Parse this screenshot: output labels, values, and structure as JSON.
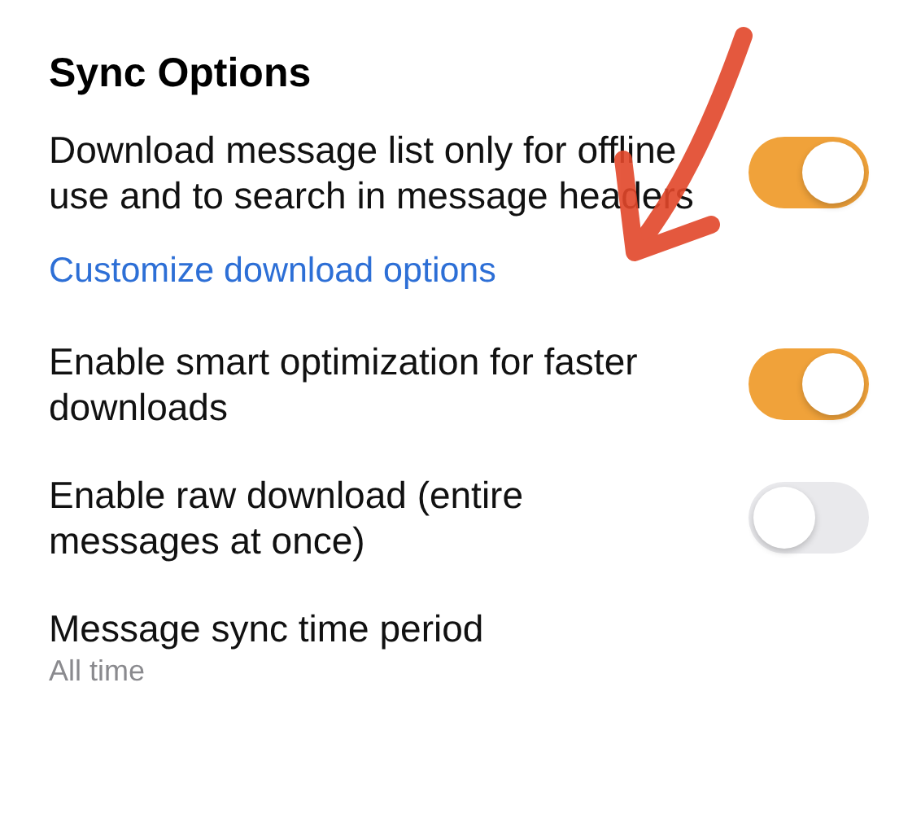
{
  "title": "Sync Options",
  "settings": [
    {
      "kind": "toggle",
      "label": "Download message list only for offline use and to search in message headers",
      "on": true,
      "link": "Customize download options"
    },
    {
      "kind": "toggle",
      "label": "Enable smart optimization for faster downloads",
      "on": true
    },
    {
      "kind": "toggle",
      "label": "Enable raw download (entire messages at once)",
      "on": false
    },
    {
      "kind": "value",
      "label": "Message sync time period",
      "value": "All time"
    }
  ]
}
